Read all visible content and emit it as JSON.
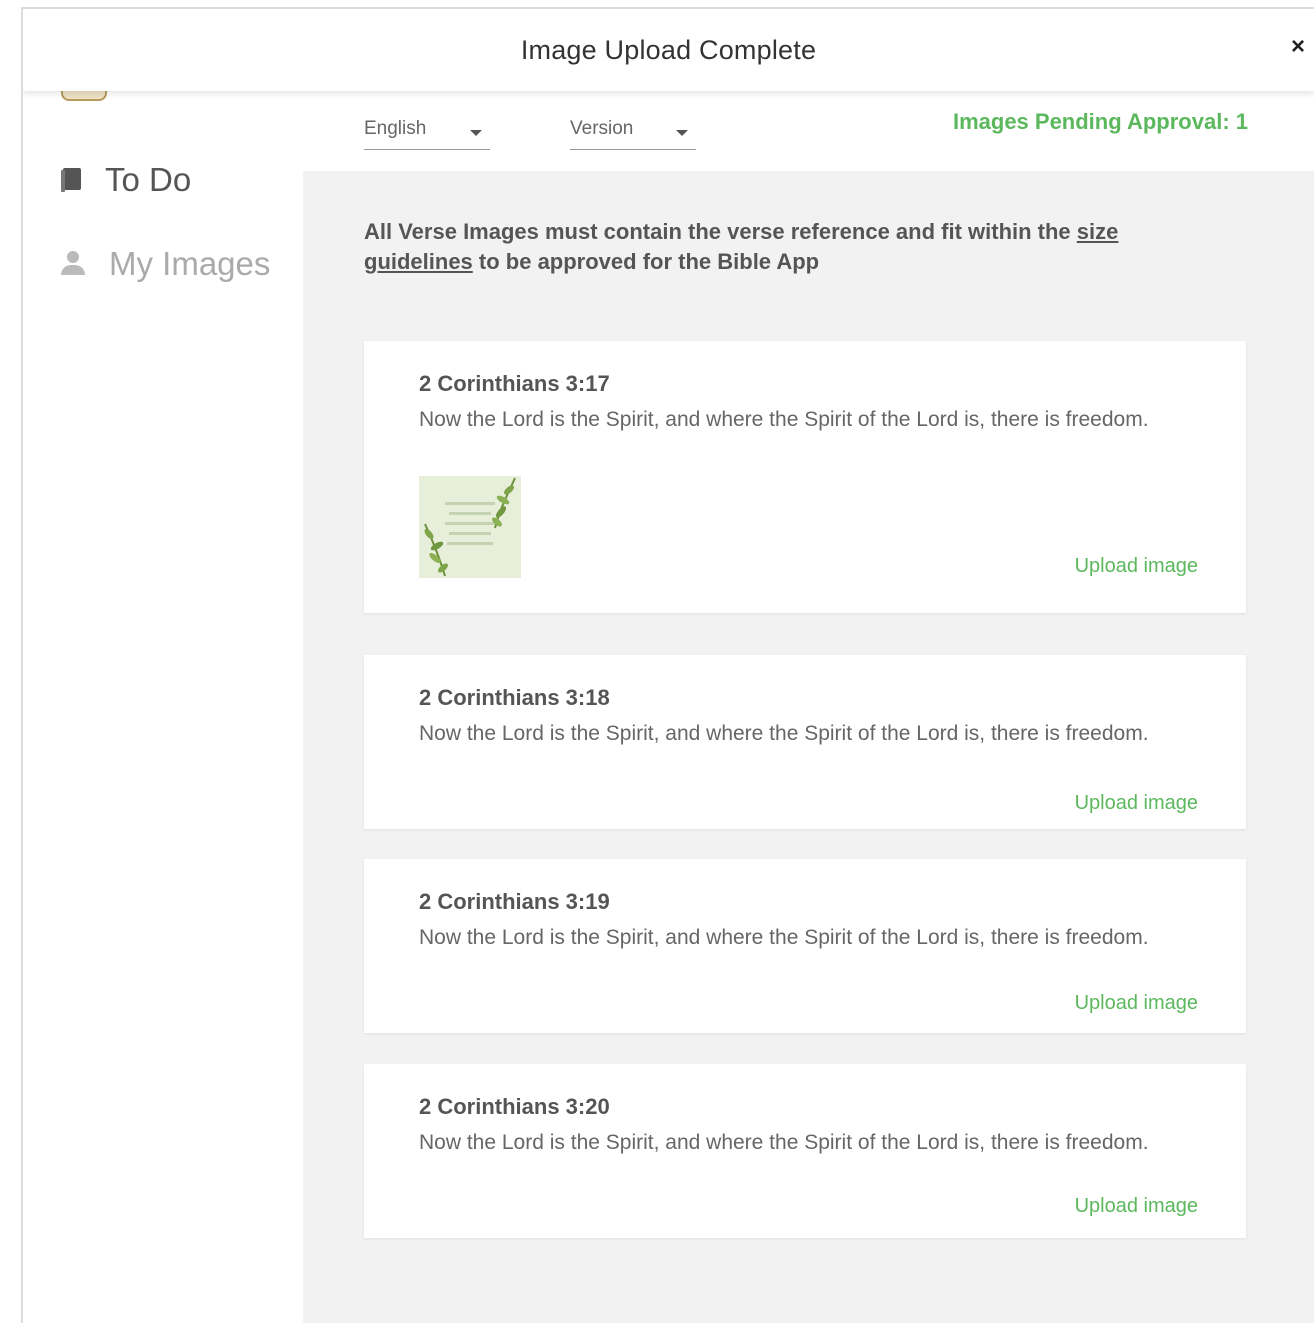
{
  "header": {
    "title": "Image Upload Complete",
    "close_label": "×"
  },
  "sidebar": {
    "items": [
      {
        "label": "To Do",
        "icon": "book-icon"
      },
      {
        "label": "My Images",
        "icon": "user-icon"
      }
    ]
  },
  "filters": {
    "language": "English",
    "version": "Version",
    "pending_label": "Images Pending Approval: 1"
  },
  "notice": {
    "text_before": "All Verse Images must contain the verse reference and fit within the ",
    "link": "size guidelines",
    "text_after": " to be approved for the Bible App"
  },
  "cards": [
    {
      "reference": "2 Corinthians 3:17",
      "verse": "Now the Lord is the Spirit, and where the Spirit of the Lord is, there is freedom.",
      "upload_label": "Upload image"
    },
    {
      "reference": "2 Corinthians 3:18",
      "verse": "Now the Lord is the Spirit, and where the Spirit of the Lord is, there is freedom.",
      "upload_label": "Upload image"
    },
    {
      "reference": "2 Corinthians 3:19",
      "verse": "Now the Lord is the Spirit, and where the Spirit of the Lord is, there is freedom.",
      "upload_label": "Upload image"
    },
    {
      "reference": "2 Corinthians 3:20",
      "verse": "Now the Lord is the Spirit, and where the Spirit of the Lord is, there is freedom.",
      "upload_label": "Upload image"
    }
  ],
  "colors": {
    "accent_green": "#5cb85c",
    "background": "#f2f2f2"
  }
}
